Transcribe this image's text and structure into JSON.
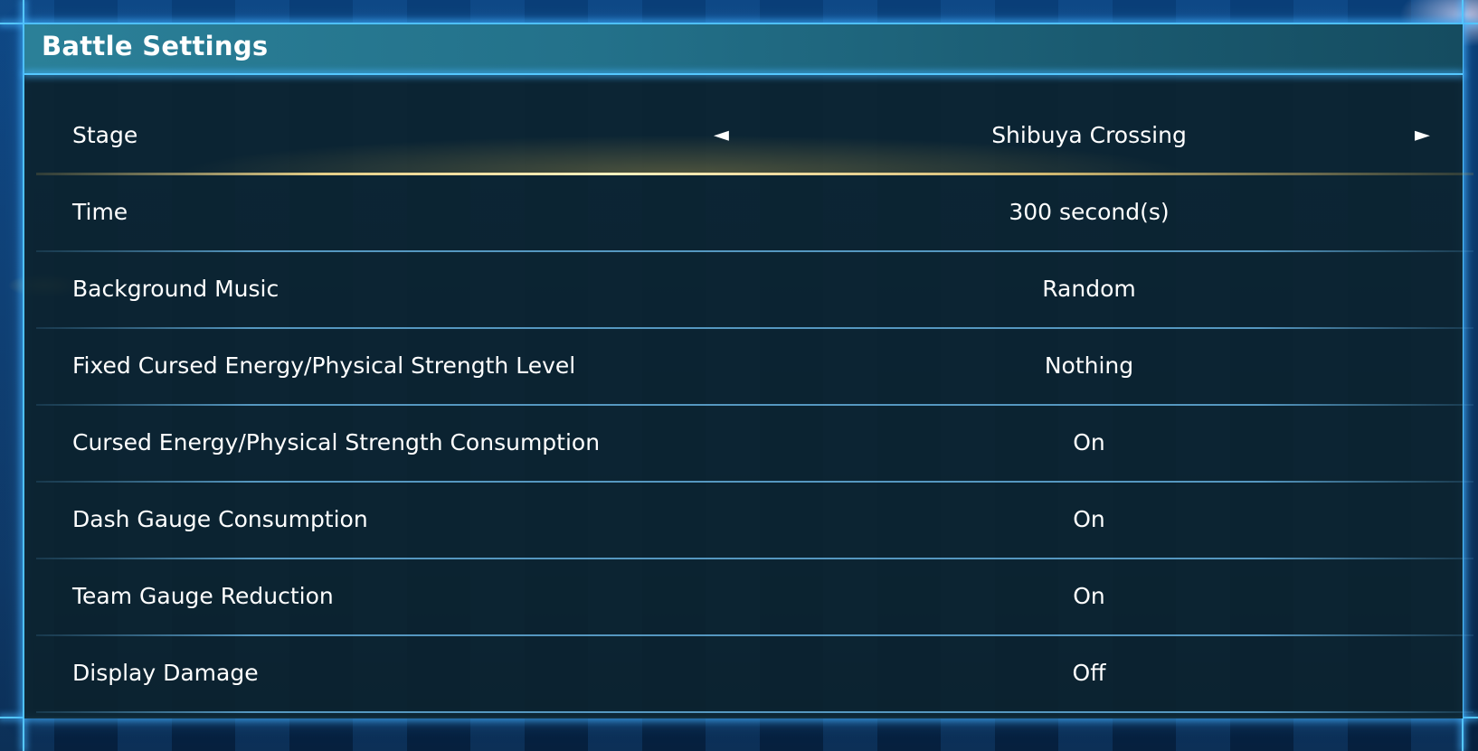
{
  "panel": {
    "title": "Battle Settings"
  },
  "settings": [
    {
      "label": "Stage",
      "value": "Shibuya Crossing",
      "selected": true
    },
    {
      "label": "Time",
      "value": "300 second(s)"
    },
    {
      "label": "Background Music",
      "value": "Random"
    },
    {
      "label": "Fixed Cursed Energy/Physical Strength Level",
      "value": "Nothing"
    },
    {
      "label": "Cursed Energy/Physical Strength Consumption",
      "value": "On"
    },
    {
      "label": "Dash Gauge Consumption",
      "value": "On"
    },
    {
      "label": "Team Gauge Reduction",
      "value": "On"
    },
    {
      "label": "Display Damage",
      "value": "Off"
    }
  ],
  "icons": {
    "left_arrow": "◄",
    "right_arrow": "►"
  },
  "colors": {
    "frame": "#55c8ff",
    "header": "#2b8098",
    "selection": "#f0d78c"
  }
}
